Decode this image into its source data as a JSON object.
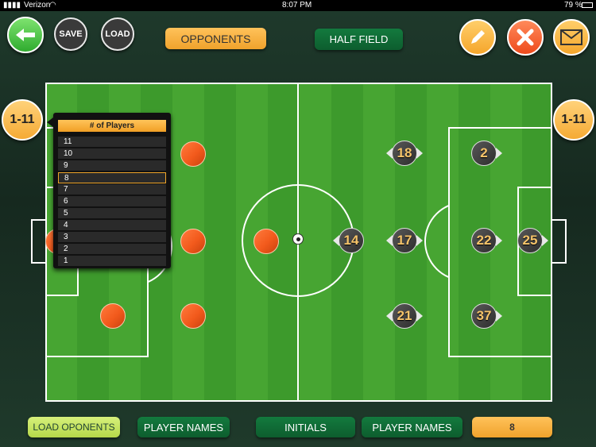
{
  "status_bar": {
    "carrier": "Verizon",
    "time": "8:07 PM",
    "battery": "79 %"
  },
  "toolbar": {
    "back_icon": "arrow-left-icon",
    "save_label": "SAVE",
    "load_label": "LOAD",
    "opponents_label": "OPPONENTS",
    "half_field_label": "HALF FIELD",
    "edit_icon": "pencil-icon",
    "delete_icon": "x-icon",
    "email_icon": "envelope-icon"
  },
  "side_badges": {
    "left": "1-11",
    "right": "1-11"
  },
  "players_popup": {
    "title": "# of Players",
    "options": [
      "11",
      "10",
      "9",
      "8",
      "7",
      "6",
      "5",
      "4",
      "3",
      "2",
      "1"
    ],
    "selected": "8"
  },
  "team_players": [
    "18",
    "2",
    "14",
    "17",
    "22",
    "25",
    "21",
    "37"
  ],
  "bottom_bar": {
    "load_opponents_label": "LOAD OPONENTS",
    "player_names_left_label": "PLAYER NAMES",
    "initials_label": "INITIALS",
    "player_names_right_label": "PLAYER NAMES",
    "count_value": "8"
  },
  "colors": {
    "accent_orange": "#f5aa34",
    "field_green": "#3f9f2e",
    "button_green": "#137a3e",
    "opponent_orange": "#f25a1c"
  }
}
